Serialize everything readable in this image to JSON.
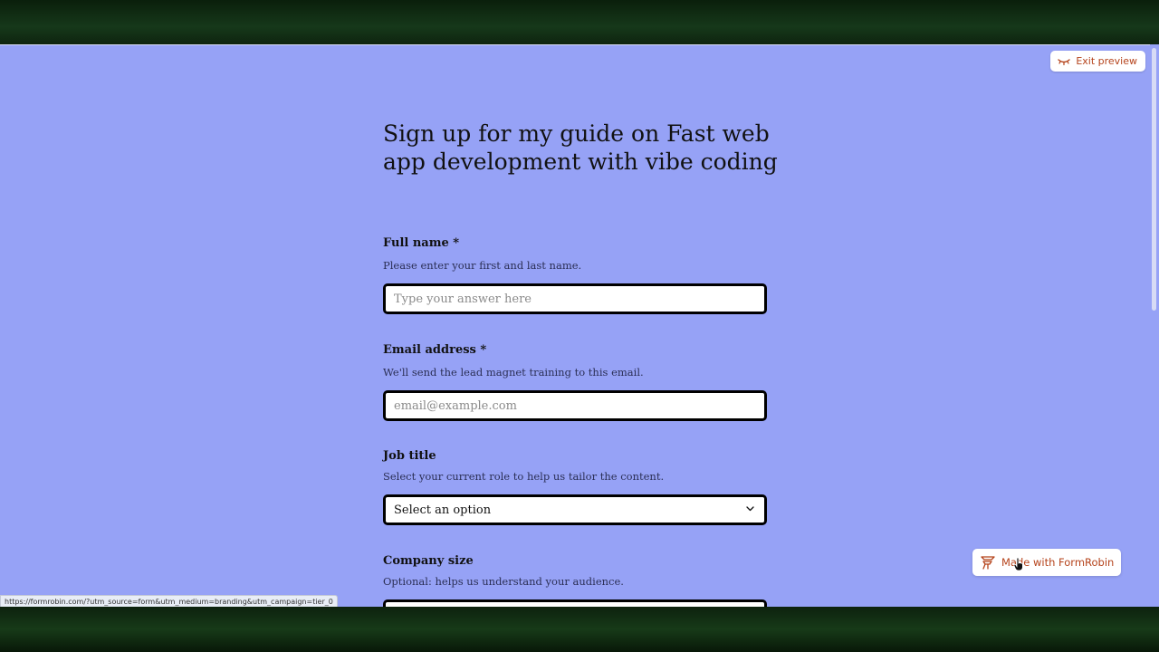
{
  "header": {
    "exit_preview_label": "Exit preview"
  },
  "form": {
    "title": "Sign up for my guide on Fast web app development with vibe coding",
    "fields": [
      {
        "label": "Full name *",
        "help": "Please enter your first and last name.",
        "placeholder": "Type your answer here"
      },
      {
        "label": "Email address *",
        "help": "We'll send the lead magnet training to this email.",
        "placeholder": "email@example.com"
      },
      {
        "label": "Job title",
        "help": "Select your current role to help us tailor the content.",
        "selected": "Select an option"
      },
      {
        "label": "Company size",
        "help": "Optional: helps us understand your audience."
      }
    ]
  },
  "branding": {
    "label": "Made with FormRobin"
  },
  "status_url": "https://formrobin.com/?utm_source=form&utm_medium=branding&utm_campaign=tier_0",
  "colors": {
    "page_bg": "#96a2f6",
    "accent": "#b5431b",
    "border": "#000000"
  },
  "icons": {
    "exit": "eye-closed-icon",
    "dropdown": "chevron-down-icon",
    "brand": "formrobin-logo-icon"
  }
}
